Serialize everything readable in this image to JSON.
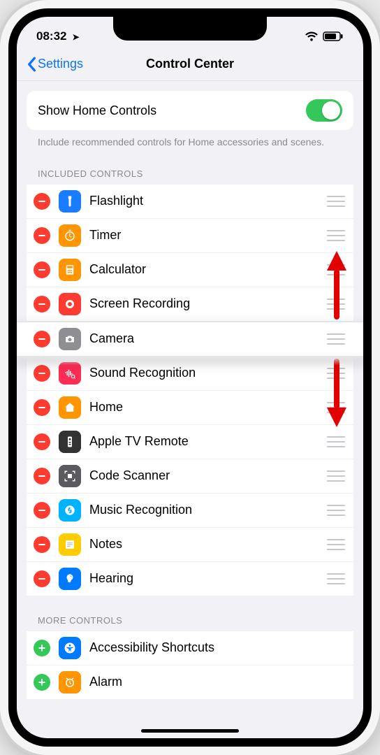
{
  "status": {
    "time": "08:32",
    "location_arrow": "➣"
  },
  "nav": {
    "back_label": "Settings",
    "title": "Control Center"
  },
  "toggle": {
    "label": "Show Home Controls",
    "on": true,
    "footer": "Include recommended controls for Home accessories and scenes."
  },
  "sections": {
    "included_header": "INCLUDED CONTROLS",
    "more_header": "MORE CONTROLS"
  },
  "included": [
    {
      "label": "Flashlight",
      "icon": "flashlight-icon",
      "color": "c-blue"
    },
    {
      "label": "Timer",
      "icon": "timer-icon",
      "color": "c-orange"
    },
    {
      "label": "Calculator",
      "icon": "calculator-icon",
      "color": "c-orange"
    },
    {
      "label": "Screen Recording",
      "icon": "record-icon",
      "color": "c-red"
    },
    {
      "label": "Camera",
      "icon": "camera-icon",
      "color": "c-grey",
      "dragging": true
    },
    {
      "label": "Sound Recognition",
      "icon": "sound-icon",
      "color": "c-pink"
    },
    {
      "label": "Home",
      "icon": "home-icon",
      "color": "c-orange"
    },
    {
      "label": "Apple TV Remote",
      "icon": "remote-icon",
      "color": "c-grey2"
    },
    {
      "label": "Code Scanner",
      "icon": "qr-icon",
      "color": "c-grey3"
    },
    {
      "label": "Music Recognition",
      "icon": "shazam-icon",
      "color": "c-cyan"
    },
    {
      "label": "Notes",
      "icon": "notes-icon",
      "color": "c-yellow"
    },
    {
      "label": "Hearing",
      "icon": "ear-icon",
      "color": "c-blue2"
    }
  ],
  "more": [
    {
      "label": "Accessibility Shortcuts",
      "icon": "accessibility-icon",
      "color": "c-blue2"
    },
    {
      "label": "Alarm",
      "icon": "alarm-icon",
      "color": "c-orange"
    }
  ]
}
